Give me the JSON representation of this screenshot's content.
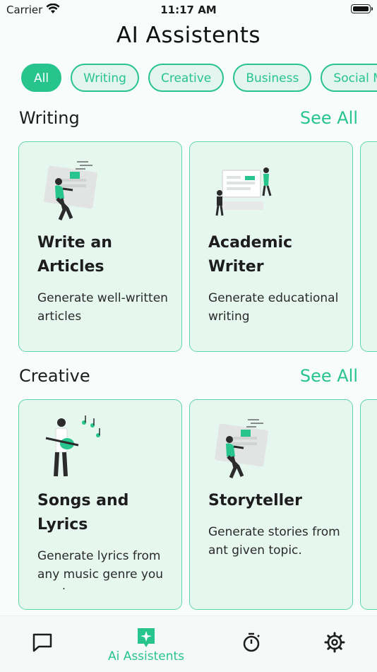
{
  "status": {
    "carrier": "Carrier",
    "time": "11:17 AM"
  },
  "header": {
    "title": "AI Assistents"
  },
  "filters": [
    "All",
    "Writing",
    "Creative",
    "Business",
    "Social Media"
  ],
  "sections": {
    "writing": {
      "title": "Writing",
      "see_all": "See All",
      "cards": [
        {
          "title": "Write an Articles",
          "description": "Generate well-written articles"
        },
        {
          "title": "Academic Writer",
          "description": "Generate educational writing"
        }
      ]
    },
    "creative": {
      "title": "Creative",
      "see_all": "See All",
      "cards": [
        {
          "title": "Songs and Lyrics",
          "description": "Generate lyrics from any music genre you want"
        },
        {
          "title": "Storyteller",
          "description": "Generate stories from ant given topic."
        }
      ]
    }
  },
  "tabbar": {
    "active_label": "Ai Assistents"
  },
  "colors": {
    "accent": "#27C48D",
    "card_bg": "#E6F7EF",
    "card_border": "#5FD6A9",
    "background": "#F8FCFA"
  }
}
